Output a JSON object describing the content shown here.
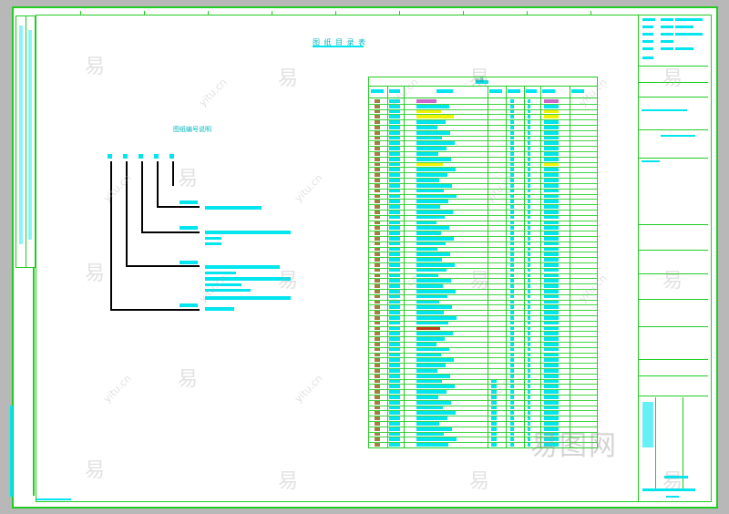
{
  "drawing": {
    "title": "图 纸 目 录 表",
    "subtitle": "图纸编号说明"
  },
  "legend": {
    "header": "目录",
    "columns": [
      "序号",
      "图号",
      "图纸名称",
      "规格",
      "版本",
      "备注",
      "日期",
      "说明"
    ],
    "row_count": 66,
    "highlight_rows": {
      "2": "#f2f200",
      "3": "#f2f200",
      "12": "#f2f200",
      "43": "#c23a1a"
    }
  },
  "watermark": {
    "brand": "易",
    "site": "yitu.cn",
    "logo": "易图网"
  },
  "colors": {
    "frame": "#22cc22",
    "text": "#00e5ee",
    "yellow": "#f2f200",
    "red": "#c23a1a",
    "magenta": "#cc66cc"
  }
}
